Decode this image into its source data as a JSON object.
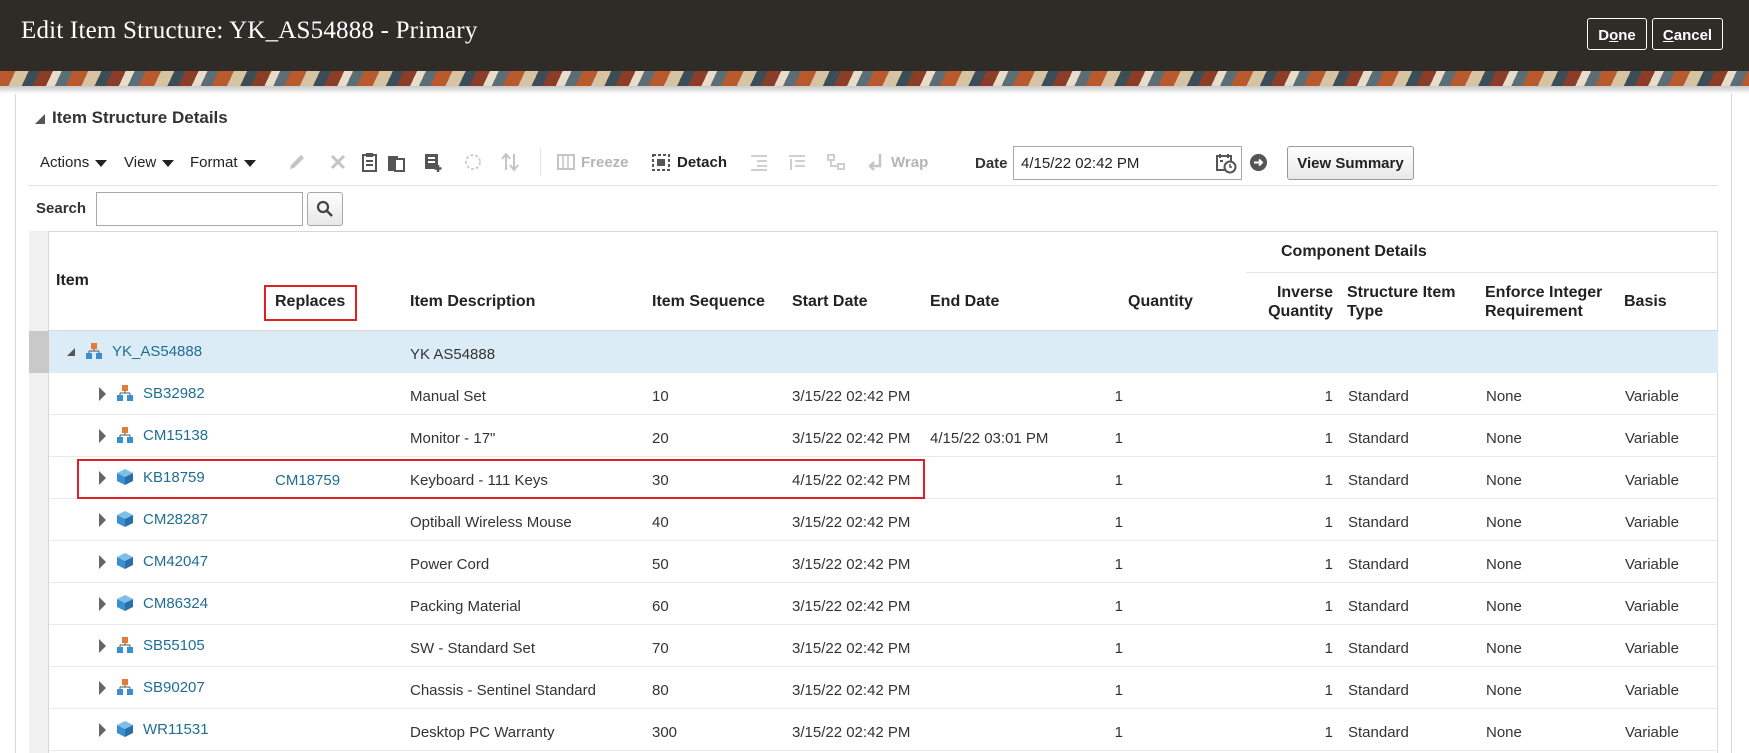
{
  "header": {
    "title": "Edit Item Structure: YK_AS54888 - Primary",
    "done_label_pre": "D",
    "done_label_u": "o",
    "done_label_post": "ne",
    "cancel_label_u": "C",
    "cancel_label_post": "ancel"
  },
  "section": {
    "title": "Item Structure Details"
  },
  "toolbar": {
    "actions": "Actions",
    "view": "View",
    "format": "Format",
    "freeze": "Freeze",
    "detach": "Detach",
    "wrap": "Wrap",
    "date_label": "Date",
    "date_value": "4/15/22 02:42 PM",
    "view_summary": "View Summary"
  },
  "search": {
    "label": "Search",
    "value": ""
  },
  "table": {
    "group_header": "Component Details",
    "columns": {
      "item": "Item",
      "replaces": "Replaces",
      "item_description": "Item Description",
      "item_sequence": "Item Sequence",
      "start_date": "Start Date",
      "end_date": "End Date",
      "quantity": "Quantity",
      "inverse_quantity_1": "Inverse",
      "inverse_quantity_2": "Quantity",
      "structure_item_type_1": "Structure Item",
      "structure_item_type_2": "Type",
      "enforce_integer_1": "Enforce Integer",
      "enforce_integer_2": "Requirement",
      "basis": "Basis"
    },
    "root": {
      "item": "YK_AS54888",
      "description": "YK AS54888"
    },
    "rows": [
      {
        "item": "SB32982",
        "replaces": "",
        "description": "Manual Set",
        "sequence": "10",
        "start": "3/15/22 02:42 PM",
        "end": "",
        "quantity": "1",
        "inverse": "1",
        "type": "Standard",
        "enforce": "None",
        "basis": "Variable",
        "icon": "structure"
      },
      {
        "item": "CM15138",
        "replaces": "",
        "description": "Monitor - 17\"",
        "sequence": "20",
        "start": "3/15/22 02:42 PM",
        "end": "4/15/22 03:01 PM",
        "quantity": "1",
        "inverse": "1",
        "type": "Standard",
        "enforce": "None",
        "basis": "Variable",
        "icon": "structure"
      },
      {
        "item": "KB18759",
        "replaces": "CM18759",
        "description": "Keyboard - 111 Keys",
        "sequence": "30",
        "start": "4/15/22 02:42 PM",
        "end": "",
        "quantity": "1",
        "inverse": "1",
        "type": "Standard",
        "enforce": "None",
        "basis": "Variable",
        "icon": "cube"
      },
      {
        "item": "CM28287",
        "replaces": "",
        "description": "Optiball Wireless Mouse",
        "sequence": "40",
        "start": "3/15/22 02:42 PM",
        "end": "",
        "quantity": "1",
        "inverse": "1",
        "type": "Standard",
        "enforce": "None",
        "basis": "Variable",
        "icon": "cube"
      },
      {
        "item": "CM42047",
        "replaces": "",
        "description": "Power Cord",
        "sequence": "50",
        "start": "3/15/22 02:42 PM",
        "end": "",
        "quantity": "1",
        "inverse": "1",
        "type": "Standard",
        "enforce": "None",
        "basis": "Variable",
        "icon": "cube"
      },
      {
        "item": "CM86324",
        "replaces": "",
        "description": "Packing Material",
        "sequence": "60",
        "start": "3/15/22 02:42 PM",
        "end": "",
        "quantity": "1",
        "inverse": "1",
        "type": "Standard",
        "enforce": "None",
        "basis": "Variable",
        "icon": "cube"
      },
      {
        "item": "SB55105",
        "replaces": "",
        "description": "SW - Standard Set",
        "sequence": "70",
        "start": "3/15/22 02:42 PM",
        "end": "",
        "quantity": "1",
        "inverse": "1",
        "type": "Standard",
        "enforce": "None",
        "basis": "Variable",
        "icon": "structure"
      },
      {
        "item": "SB90207",
        "replaces": "",
        "description": "Chassis - Sentinel Standard",
        "sequence": "80",
        "start": "3/15/22 02:42 PM",
        "end": "",
        "quantity": "1",
        "inverse": "1",
        "type": "Standard",
        "enforce": "None",
        "basis": "Variable",
        "icon": "structure"
      },
      {
        "item": "WR11531",
        "replaces": "",
        "description": "Desktop PC Warranty",
        "sequence": "300",
        "start": "3/15/22 02:42 PM",
        "end": "",
        "quantity": "1",
        "inverse": "1",
        "type": "Standard",
        "enforce": "None",
        "basis": "Variable",
        "icon": "cube"
      }
    ]
  },
  "colors": {
    "header_bg": "#2f2b27",
    "link": "#1f6e92",
    "selected_row": "#dcecf7",
    "highlight": "#e01f26"
  }
}
